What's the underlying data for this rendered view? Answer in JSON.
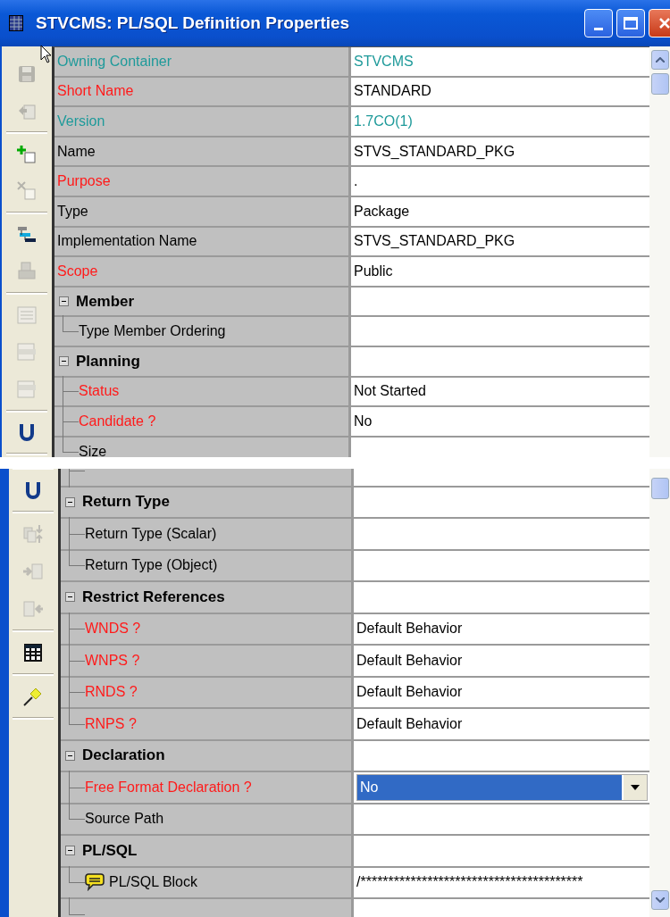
{
  "window": {
    "title": "STVCMS: PL/SQL Definition Properties"
  },
  "panels": [
    {
      "toolbar": [
        {
          "kind": "save",
          "disabled": true
        },
        {
          "kind": "paste",
          "disabled": true
        },
        {
          "kind": "separator"
        },
        {
          "kind": "add",
          "disabled": false
        },
        {
          "kind": "delete",
          "disabled": true
        },
        {
          "kind": "separator"
        },
        {
          "kind": "hierarchy",
          "disabled": false
        },
        {
          "kind": "printer",
          "disabled": true
        },
        {
          "kind": "separator"
        },
        {
          "kind": "form",
          "disabled": true
        },
        {
          "kind": "ascii",
          "disabled": true
        },
        {
          "kind": "html",
          "disabled": true
        },
        {
          "kind": "separator"
        },
        {
          "kind": "underline",
          "disabled": false
        },
        {
          "kind": "separator"
        }
      ],
      "rows": [
        {
          "kind": "property",
          "label": "Owning Container",
          "value": "STVCMS",
          "color": "#1e9a9a",
          "readonly": true
        },
        {
          "kind": "property",
          "label": "Short Name",
          "value": "STANDARD",
          "color": "#ff1a1a",
          "readonly": false
        },
        {
          "kind": "property",
          "label": "Version",
          "value": "1.7CO(1)",
          "color": "#1e9a9a",
          "readonly": true
        },
        {
          "kind": "property",
          "label": "Name",
          "value": "STVS_STANDARD_PKG",
          "color": "#000000",
          "readonly": false
        },
        {
          "kind": "property",
          "label": "Purpose",
          "value": ".",
          "color": "#ff1a1a",
          "readonly": false
        },
        {
          "kind": "property",
          "label": "Type",
          "value": "Package",
          "color": "#000000",
          "readonly": false
        },
        {
          "kind": "property",
          "label": "Implementation Name",
          "value": "STVS_STANDARD_PKG",
          "color": "#000000",
          "readonly": false
        },
        {
          "kind": "property",
          "label": "Scope",
          "value": "Public",
          "color": "#ff1a1a",
          "readonly": false
        },
        {
          "kind": "group",
          "label": "Member",
          "expanded": true,
          "children": [
            {
              "kind": "property",
              "label": "Type Member Ordering",
              "color": "#000000"
            }
          ]
        },
        {
          "kind": "group",
          "label": "Planning",
          "expanded": true,
          "children": [
            {
              "kind": "property",
              "label": "Status",
              "value": "Not Started",
              "color": "#ff1a1a",
              "readonly": false
            },
            {
              "kind": "property",
              "label": "Candidate ?",
              "value": "No",
              "color": "#ff1a1a",
              "readonly": false
            },
            {
              "kind": "property",
              "label": "Size",
              "color": "#000000"
            }
          ]
        }
      ]
    },
    {
      "toolbar": [
        {
          "kind": "separator"
        },
        {
          "kind": "underline",
          "disabled": false
        },
        {
          "kind": "separator"
        },
        {
          "kind": "copy",
          "disabled": true
        },
        {
          "kind": "import",
          "disabled": true
        },
        {
          "kind": "export",
          "disabled": true
        },
        {
          "kind": "separator"
        },
        {
          "kind": "table",
          "disabled": false
        },
        {
          "kind": "separator"
        },
        {
          "kind": "pin",
          "disabled": false
        },
        {
          "kind": "separator"
        }
      ],
      "rows": [
        {
          "kind": "group",
          "label": "Return Type",
          "expanded": true,
          "children": [
            {
              "kind": "property",
              "label": "Return Type (Scalar)",
              "color": "#000000"
            },
            {
              "kind": "property",
              "label": "Return Type (Object)",
              "color": "#000000"
            }
          ]
        },
        {
          "kind": "group",
          "label": "Restrict References",
          "expanded": true,
          "children": [
            {
              "kind": "property",
              "label": "WNDS ?",
              "value": "Default Behavior",
              "color": "#ff1a1a",
              "readonly": false
            },
            {
              "kind": "property",
              "label": "WNPS ?",
              "value": "Default Behavior",
              "color": "#ff1a1a",
              "readonly": false
            },
            {
              "kind": "property",
              "label": "RNDS ?",
              "value": "Default Behavior",
              "color": "#ff1a1a",
              "readonly": false
            },
            {
              "kind": "property",
              "label": "RNPS ?",
              "value": "Default Behavior",
              "color": "#ff1a1a",
              "readonly": false
            }
          ]
        },
        {
          "kind": "group",
          "label": "Declaration",
          "expanded": true,
          "children": [
            {
              "kind": "dropdown",
              "label": "Free Format Declaration ?",
              "value": "No",
              "selected": true,
              "color": "#ff1a1a"
            },
            {
              "kind": "property",
              "label": "Source Path",
              "color": "#000000"
            }
          ]
        },
        {
          "kind": "group",
          "label": "PL/SQL",
          "expanded": true,
          "children": [
            {
              "kind": "note",
              "label": "PL/SQL Block",
              "value": "/****************************************",
              "color": "#000000",
              "readonly": false
            }
          ]
        }
      ]
    }
  ]
}
